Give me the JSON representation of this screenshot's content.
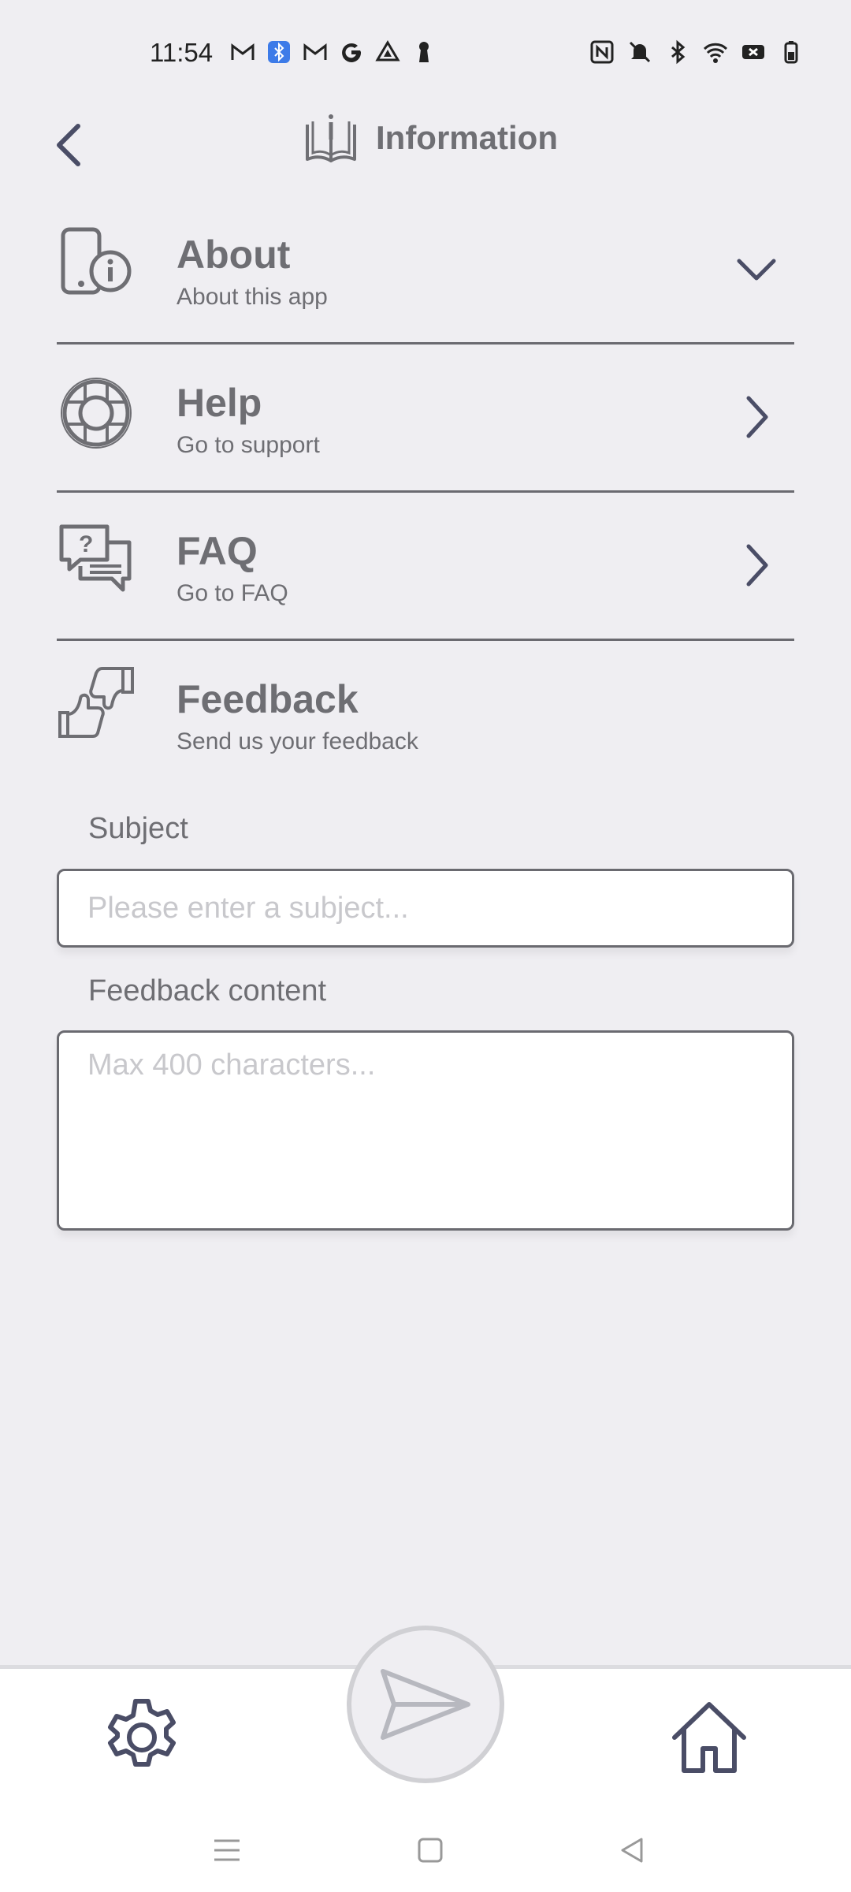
{
  "status_bar": {
    "time": "11:54",
    "notification_icons": [
      "gmail-icon",
      "bluetooth-icon",
      "gmail-icon",
      "google-icon",
      "drive-icon",
      "keyhole-icon"
    ],
    "system_icons": [
      "nfc-icon",
      "mute-icon",
      "bluetooth-icon",
      "wifi-icon",
      "battery-saver-icon",
      "battery-icon"
    ]
  },
  "header": {
    "title": "Information",
    "icon": "info-book-icon"
  },
  "menu": {
    "items": [
      {
        "title": "About",
        "subtitle": "About this app",
        "icon": "phone-info-icon",
        "chevron": "chevron-down-icon"
      },
      {
        "title": "Help",
        "subtitle": "Go to support",
        "icon": "lifebuoy-icon",
        "chevron": "chevron-right-icon"
      },
      {
        "title": "FAQ",
        "subtitle": "Go to FAQ",
        "icon": "faq-chat-icon",
        "chevron": "chevron-right-icon"
      }
    ]
  },
  "feedback": {
    "title": "Feedback",
    "subtitle": "Send us your feedback",
    "icon": "thumbs-feedback-icon",
    "subject_label": "Subject",
    "subject_placeholder": "Please enter a subject...",
    "subject_value": "",
    "content_label": "Feedback content",
    "content_placeholder": "Max 400 characters...",
    "content_value": ""
  },
  "bottom_bar": {
    "left": "settings-gear-icon",
    "center": "send-icon",
    "right": "home-icon"
  },
  "nav_bar": [
    "menu-nav-icon",
    "home-square-icon",
    "back-triangle-icon"
  ],
  "colors": {
    "background": "#efeef2",
    "text": "#6e6e73",
    "icon_dark": "#4a4d66",
    "divider": "#6a6a70"
  }
}
